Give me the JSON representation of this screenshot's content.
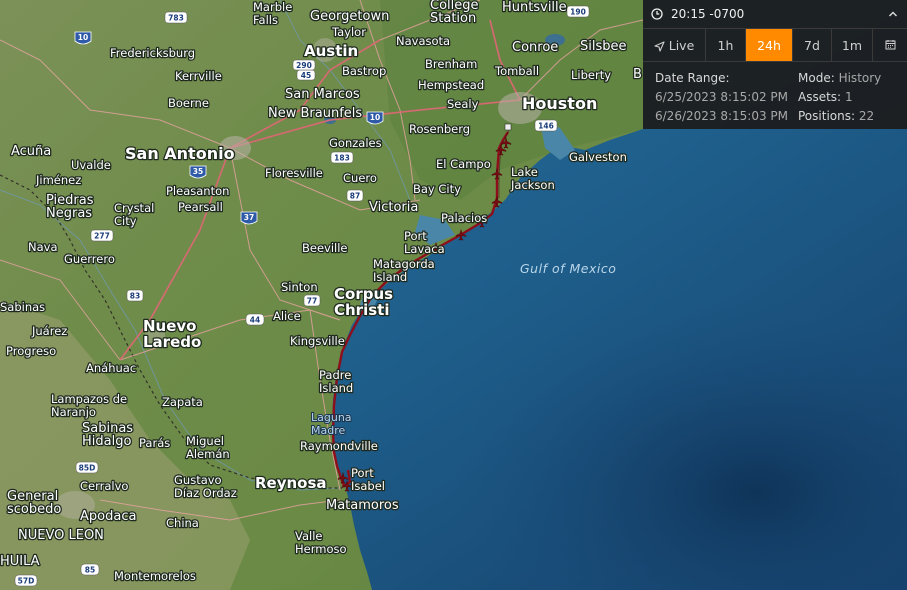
{
  "panel": {
    "time": "20:15 -0700",
    "tabs": [
      {
        "label": "Live",
        "icon": "navigation-arrow-icon"
      },
      {
        "label": "1h"
      },
      {
        "label": "24h",
        "active": true
      },
      {
        "label": "7d"
      },
      {
        "label": "1m"
      },
      {
        "label": "",
        "icon": "calendar-icon"
      }
    ],
    "date_range_label": "Date Range:",
    "date_start": "6/25/2023 8:15:02 PM",
    "date_end": "6/26/2023 8:15:03 PM",
    "mode_label": "Mode:",
    "mode_value": "History",
    "assets_label": "Assets:",
    "assets_value": "1",
    "positions_label": "Positions:",
    "positions_value": "22"
  },
  "map": {
    "places": {
      "marble_falls": "Marble\nFalls",
      "georgetown": "Georgetown",
      "college_station": "College\nStation",
      "huntsville": "Huntsville",
      "taylor": "Taylor",
      "navasota": "Navasota",
      "conroe": "Conroe",
      "silsbee": "Silsbee",
      "fredericksburg": "Fredericksburg",
      "austin": "Austin",
      "brenham": "Brenham",
      "tomball": "Tomball",
      "liberty": "Liberty",
      "beaumont_partial": "B",
      "kerrville": "Kerrville",
      "bastrop": "Bastrop",
      "hempstead": "Hempstead",
      "boerne": "Boerne",
      "san_marcos": "San Marcos",
      "sealy": "Sealy",
      "houston": "Houston",
      "new_braunfels": "New Braunfels",
      "rosenberg": "Rosenberg",
      "acuna": "Acuña",
      "san_antonio": "San Antonio",
      "gonzales": "Gonzales",
      "galveston": "Galveston",
      "uvalde": "Uvalde",
      "el_campo": "El Campo",
      "jimenez": "Jiménez",
      "floresville": "Floresville",
      "cuero": "Cuero",
      "lake_jackson": "Lake\nJackson",
      "piedras_negras": "Piedras\nNegras",
      "pleasanton": "Pleasanton",
      "bay_city": "Bay City",
      "pearsall": "Pearsall",
      "crystal_city": "Crystal\nCity",
      "victoria": "Victoria",
      "palacios": "Palacios",
      "nava": "Nava",
      "guerrero": "Guerrero",
      "beeville": "Beeville",
      "port_lavaca": "Port\nLavaca",
      "matagorda_island": "Matagorda\nIsland",
      "sinton": "Sinton",
      "corpus_christi": "Corpus\nChristi",
      "sabinas": "Sabinas",
      "nuevo_laredo": "Nuevo\nLaredo",
      "alice": "Alice",
      "juarez": "Juárez",
      "progreso": "Progreso",
      "kingsville": "Kingsville",
      "anahuac": "Anáhuac",
      "padre_island": "Padre\nIsland",
      "lampazos": "Lampazos de\nNaranjo",
      "zapata": "Zapata",
      "laguna_madre": "Laguna\nMadre",
      "sabinas_hidalgo": "Sabinas\nHidalgo",
      "paras": "Parás",
      "miguel_aleman": "Miguel\nAlemán",
      "raymondville": "Raymondville",
      "port_isabel": "Port\nIsabel",
      "cerralvo": "Cerralvo",
      "gustavo_diaz_ordaz": "Gustavo\nDíaz Ordaz",
      "reynosa": "Reynosa",
      "general_escobedo": "General\nscobedo",
      "matamoros": "Matamoros",
      "apodaca": "Apodaca",
      "nuevo_leon": "NUEVO LEON",
      "china": "China",
      "valle_hermoso": "Valle\nHermoso",
      "coahuila_partial": "HUILA",
      "montemorelos": "Montemorelos",
      "gulf_of_mexico": "Gulf of Mexico"
    },
    "shields": [
      "783",
      "190",
      "10",
      "45",
      "290",
      "146",
      "35",
      "10",
      "183",
      "87",
      "37",
      "277",
      "83",
      "77",
      "44",
      "85D",
      "85",
      "57D"
    ]
  }
}
